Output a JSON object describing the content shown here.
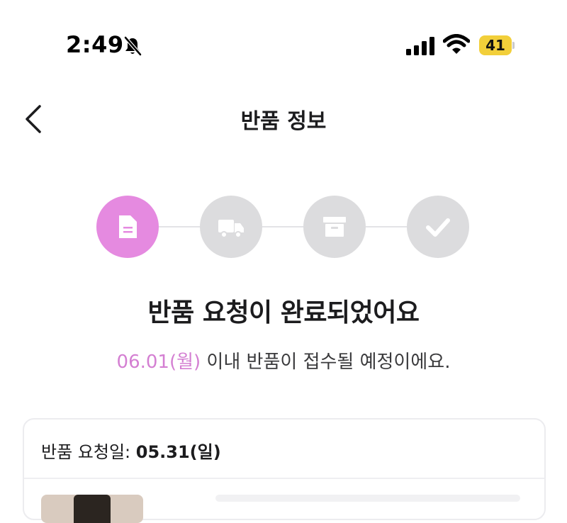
{
  "status_bar": {
    "time": "2:49",
    "icons": [
      "bell-slash-icon",
      "cellular-signal-icon",
      "wifi-icon"
    ],
    "battery": "41",
    "battery_color": "#f2cf3a"
  },
  "header": {
    "back_icon": "chevron-left-icon",
    "title": "반품 정보"
  },
  "progress": {
    "active_color": "#e58ae0",
    "inactive_color": "#dcdcde",
    "steps": [
      {
        "icon": "document-icon",
        "state": "active"
      },
      {
        "icon": "truck-icon",
        "state": "inactive"
      },
      {
        "icon": "archive-box-icon",
        "state": "inactive"
      },
      {
        "icon": "checkmark-icon",
        "state": "inactive"
      }
    ]
  },
  "headline": "반품 요청이 완료되었어요",
  "subline": {
    "date": "06.01(월)",
    "rest": " 이내 반품이 접수될 예정이에요."
  },
  "card": {
    "request_label": "반품 요청일: ",
    "request_date": "05.31(일)"
  }
}
